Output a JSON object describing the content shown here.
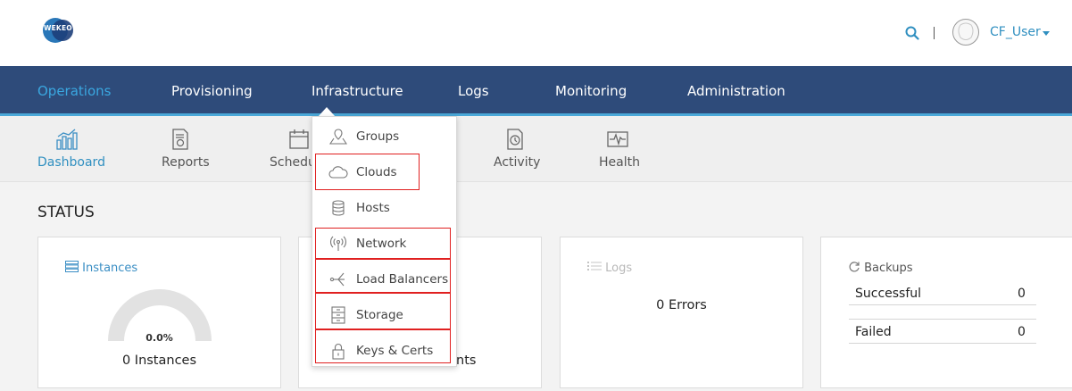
{
  "header": {
    "logo_text": "WEKEO",
    "user_name": "CF_User"
  },
  "main_nav": {
    "items": [
      {
        "label": "Operations",
        "active": true
      },
      {
        "label": "Provisioning"
      },
      {
        "label": "Infrastructure"
      },
      {
        "label": "Logs"
      },
      {
        "label": "Monitoring"
      },
      {
        "label": "Administration"
      }
    ]
  },
  "sub_nav": {
    "items": [
      {
        "label": "Dashboard",
        "icon": "dashboard-chart-icon",
        "active": true
      },
      {
        "label": "Reports",
        "icon": "reports-icon"
      },
      {
        "label": "Schedu",
        "icon": "calendar-icon"
      },
      {
        "label": "Activity",
        "icon": "activity-clock-icon"
      },
      {
        "label": "Health",
        "icon": "health-pulse-icon"
      }
    ]
  },
  "status": {
    "title": "STATUS",
    "instances": {
      "title": "Instances",
      "percent": "0.0%",
      "fraction": 0.0,
      "count_label": "0 Instances"
    },
    "second_card": {
      "partial_label": "nts"
    },
    "logs": {
      "title": "Logs",
      "errors_label": "0 Errors"
    },
    "backups": {
      "title": "Backups",
      "rows": [
        {
          "label": "Successful",
          "value": "0"
        },
        {
          "label": "Failed",
          "value": "0"
        }
      ]
    }
  },
  "infrastructure_menu": {
    "items": [
      {
        "label": "Groups",
        "icon": "map-pin-icon",
        "highlighted": false
      },
      {
        "label": "Clouds",
        "icon": "cloud-icon",
        "highlighted": true
      },
      {
        "label": "Hosts",
        "icon": "database-icon",
        "highlighted": false
      },
      {
        "label": "Network",
        "icon": "antenna-icon",
        "highlighted": true
      },
      {
        "label": "Load Balancers",
        "icon": "share-nodes-icon",
        "highlighted": true
      },
      {
        "label": "Storage",
        "icon": "file-cabinet-icon",
        "highlighted": true
      },
      {
        "label": "Keys & Certs",
        "icon": "lock-icon",
        "highlighted": true
      }
    ]
  },
  "colors": {
    "nav_bg": "#2e4b7a",
    "accent": "#3aa7e0",
    "highlight_box": "#e02020"
  }
}
